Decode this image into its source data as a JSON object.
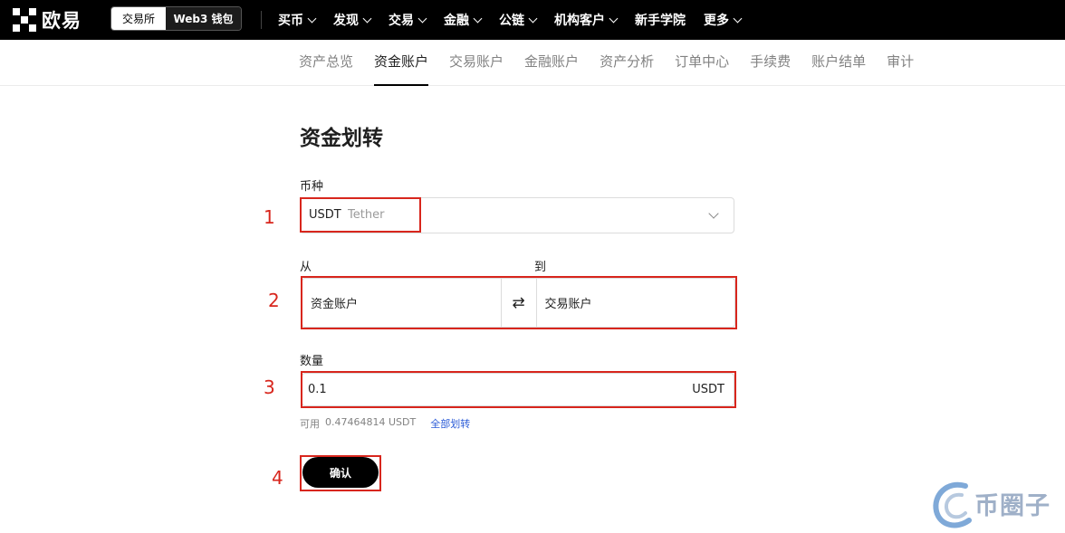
{
  "nav": {
    "logo_text": "欧易",
    "segment": {
      "active": "交易所",
      "inactive": "Web3 钱包"
    },
    "menu": [
      {
        "label": "买币",
        "dropdown": true
      },
      {
        "label": "发现",
        "dropdown": true
      },
      {
        "label": "交易",
        "dropdown": true
      },
      {
        "label": "金融",
        "dropdown": true
      },
      {
        "label": "公链",
        "dropdown": true
      },
      {
        "label": "机构客户",
        "dropdown": true
      },
      {
        "label": "新手学院",
        "dropdown": false
      },
      {
        "label": "更多",
        "dropdown": true
      }
    ]
  },
  "tabs": [
    {
      "label": "资产总览",
      "active": false
    },
    {
      "label": "资金账户",
      "active": true
    },
    {
      "label": "交易账户",
      "active": false
    },
    {
      "label": "金融账户",
      "active": false
    },
    {
      "label": "资产分析",
      "active": false
    },
    {
      "label": "订单中心",
      "active": false
    },
    {
      "label": "手续费",
      "active": false
    },
    {
      "label": "账户结单",
      "active": false
    },
    {
      "label": "审计",
      "active": false
    }
  ],
  "form": {
    "title": "资金划转",
    "coin_label": "币种",
    "coin_code": "USDT",
    "coin_name": "Tether",
    "from_label": "从",
    "to_label": "到",
    "from_value": "资金账户",
    "to_value": "交易账户",
    "swap_glyph": "⇄",
    "amount_label": "数量",
    "amount_value": "0.1",
    "amount_unit": "USDT",
    "available_label": "可用",
    "available_value": "0.47464814 USDT",
    "transfer_all": "全部划转",
    "confirm": "确认"
  },
  "annotations": {
    "step1": "1",
    "step2": "2",
    "step3": "3",
    "step4": "4"
  },
  "watermark": "币圈子",
  "colors": {
    "accent_red": "#d8261d",
    "link_blue": "#2a5bd7",
    "nav_bg": "#000000"
  }
}
